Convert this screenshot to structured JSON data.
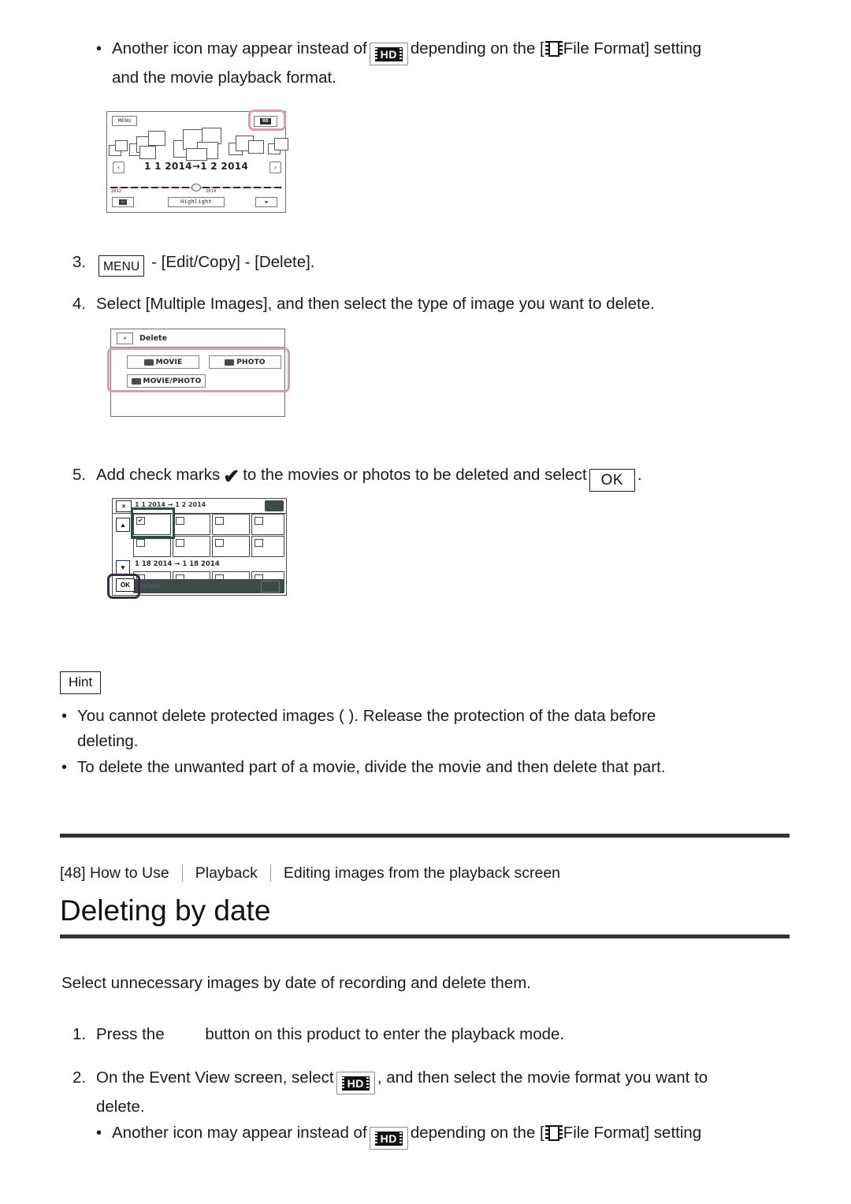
{
  "document": {
    "top_note": {
      "bullet": "•",
      "text_before": "Another icon may appear instead of",
      "icon_hd": "HD",
      "text_middle": "depending on the [",
      "icon_file_format": "film-strip-icon",
      "text_after": "File Format] setting",
      "line2": "and the movie playback format."
    },
    "steps": [
      {
        "number": "3.",
        "chip": "MENU",
        "text": "- [Edit/Copy] - [Delete]."
      },
      {
        "number": "4.",
        "text": "Select [Multiple Images], and then select the type of image you want to delete."
      },
      {
        "number": "5.",
        "text_before": "Add check marks",
        "checkmark": "✔",
        "text_middle": "to the movies or photos to be deleted and select",
        "chip_ok": "OK",
        "text_after": "."
      }
    ],
    "hint": {
      "label": "Hint",
      "bullets": [
        {
          "bullet": "•",
          "line1": "You cannot delete protected images (      ). Release the protection of the data before",
          "line2": "deleting."
        },
        {
          "bullet": "•",
          "line1": "To delete the unwanted part of a movie, divide the movie and then delete that part."
        }
      ]
    },
    "breadcrumb": {
      "item1": "[48] How to Use",
      "item2": "Playback",
      "item3": "Editing images from the playback screen"
    },
    "page_title": "Deleting by date",
    "intro": "Select unnecessary images by date of recording and delete them.",
    "steps2": [
      {
        "number": "1.",
        "text_before": "Press the",
        "text_after": "button on this product to enter the playback mode."
      },
      {
        "number": "2.",
        "text_before": "On the Event View screen, select",
        "icon_hd": "HD",
        "text_after": ", and then select the movie format you want to",
        "line2": "delete."
      }
    ],
    "bottom_note": {
      "bullet": "•",
      "text_before": "Another icon may appear instead of",
      "icon_hd": "HD",
      "text_middle": "depending on the [",
      "text_after": "File Format] setting"
    }
  },
  "screenshots": {
    "event_view": {
      "menu_button": "MENU",
      "hd_button": "HD",
      "prev_button": "‹",
      "next_button": "›",
      "date_range": "1 1 2014→1 2 2014",
      "timeline_year_left": "2012",
      "timeline_year_right": "2014",
      "bottom_left_button": "movie-icon",
      "highlight_button": "Highlight",
      "bottom_right_button": "map-icon",
      "highlight_color": "#d79fae"
    },
    "delete_dialog": {
      "close_button": "×",
      "title": "Delete",
      "buttons": [
        "MOVIE",
        "PHOTO",
        "MOVIE/PHOTO"
      ],
      "highlight_color": "#d79fae"
    },
    "multi_select": {
      "close_button": "×",
      "date_top": "1 1 2014 → 1 2 2014",
      "scroll_up": "▲",
      "scroll_down": "▼",
      "ok_button": "OK",
      "date_middle": "1 18 2014 → 1 18 2014",
      "bottom_label": "Delete",
      "checked_first_cell": true,
      "highlight_color_cells": "#2c4b45",
      "highlight_color_ok": "#3d2a44"
    }
  }
}
